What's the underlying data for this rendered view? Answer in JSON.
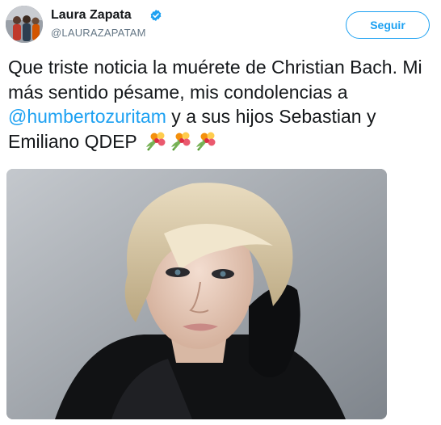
{
  "tweet": {
    "author": {
      "display_name": "Laura Zapata",
      "handle": "@LAURAZAPATAM",
      "verified": true,
      "avatar_icon": "profile-photo"
    },
    "follow_label": "Seguir",
    "text": {
      "before_mention": "Que triste noticia la muérete de Christian Bach. Mi más sentido pésame, mis condolencias a ",
      "mention": "@humbertozuritam",
      "after_mention": " y a sus hijos Sebastian y Emiliano QDEP",
      "emoji": [
        "bouquet-icon",
        "bouquet-icon",
        "bouquet-icon"
      ]
    },
    "media": {
      "kind": "photo",
      "subject_icon": "portrait-photo"
    },
    "colors": {
      "accent": "#1da1f2",
      "text": "#14171a",
      "secondary": "#657786"
    }
  }
}
